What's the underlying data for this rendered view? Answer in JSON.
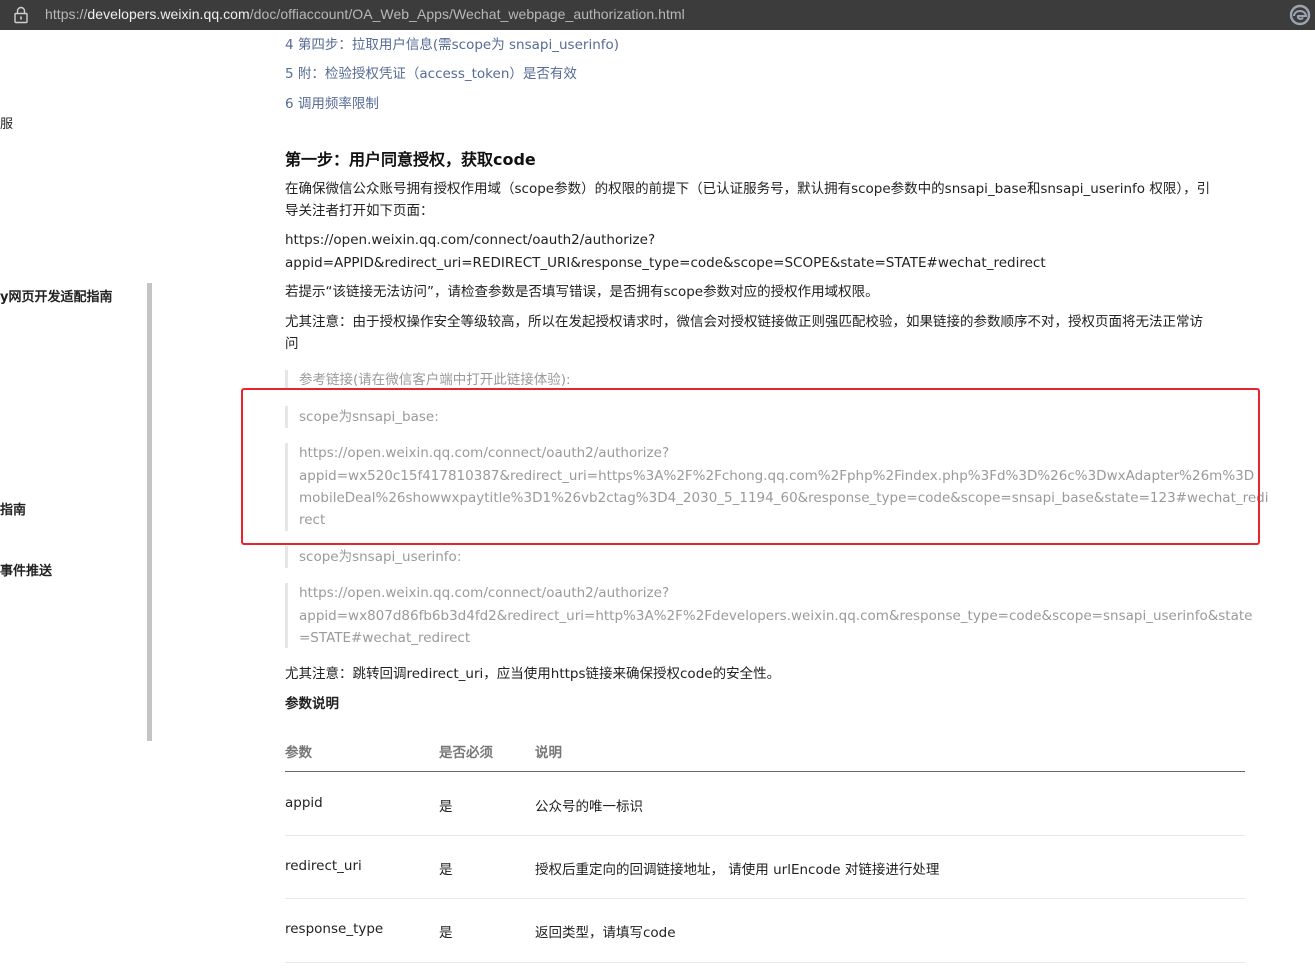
{
  "browser": {
    "url_prefix": "https://",
    "url_host": "developers.weixin.qq.com",
    "url_path": "/doc/offiaccount/OA_Web_Apps/Wechat_webpage_authorization.html"
  },
  "sidebar": {
    "items": [
      {
        "label": "服"
      },
      {
        "label": "y网页开发适配指南"
      },
      {
        "label": "指南"
      },
      {
        "label": "事件推送"
      }
    ]
  },
  "toc": {
    "items": [
      {
        "label": "4 第四步：拉取用户信息(需scope为 snsapi_userinfo)"
      },
      {
        "label": "5 附：检验授权凭证（access_token）是否有效"
      },
      {
        "label": "6 调用频率限制"
      }
    ]
  },
  "section": {
    "title": "第一步：用户同意授权，获取code",
    "intro_line1": "在确保微信公众账号拥有授权作用域（scope参数）的权限的前提下（已认证服务号，默认拥有scope参数中的snsapi_base和snsapi_userinfo 权限），引",
    "intro_line2": "导关注者打开如下页面：",
    "auth_url_line1": "https://open.weixin.qq.com/connect/oauth2/authorize?",
    "auth_url_line2": "appid=APPID&redirect_uri=REDIRECT_URI&response_type=code&scope=SCOPE&state=STATE#wechat_redirect",
    "hint": "若提示“该链接无法访问”，请检查参数是否填写错误，是否拥有scope参数对应的授权作用域权限。",
    "note_line1": "尤其注意：由于授权操作安全等级较高，所以在发起授权请求时，微信会对授权链接做正则强匹配校验，如果链接的参数顺序不对，授权页面将无法正常访",
    "note_line2": "问",
    "ref_title": "参考链接(请在微信客户端中打开此链接体验):",
    "base_label": "scope为snsapi_base:",
    "base_url_line1": "https://open.weixin.qq.com/connect/oauth2/authorize?",
    "base_url_line2": "appid=wx520c15f417810387&redirect_uri=https%3A%2F%2Fchong.qq.com%2Fphp%2Findex.php%3Fd%3D%26c%3DwxAdapter%26m%3D",
    "base_url_line3": "mobileDeal%26showwxpaytitle%3D1%26vb2ctag%3D4_2030_5_1194_60&response_type=code&scope=snsapi_base&state=123#wechat_redi",
    "base_url_line4": "rect",
    "userinfo_label": "scope为snsapi_userinfo:",
    "userinfo_url_line1": "https://open.weixin.qq.com/connect/oauth2/authorize?",
    "userinfo_url_line2": "appid=wx807d86fb6b3d4fd2&redirect_uri=http%3A%2F%2Fdevelopers.weixin.qq.com&response_type=code&scope=snsapi_userinfo&state",
    "userinfo_url_line3": "=STATE#wechat_redirect",
    "https_note": "尤其注意：跳转回调redirect_uri，应当使用https链接来确保授权code的安全性。",
    "params_title": "参数说明"
  },
  "table": {
    "headers": [
      "参数",
      "是否必须",
      "说明"
    ],
    "rows": [
      {
        "param": "appid",
        "required": "是",
        "desc": "公众号的唯一标识"
      },
      {
        "param": "redirect_uri",
        "required": "是",
        "desc": "授权后重定向的回调链接地址， 请使用 urlEncode 对链接进行处理"
      },
      {
        "param": "response_type",
        "required": "是",
        "desc": "返回类型，请填写code"
      }
    ]
  },
  "colors": {
    "link": "#576b95",
    "highlight_box": "#e8242f",
    "addressbar": "#3c3c3c"
  }
}
